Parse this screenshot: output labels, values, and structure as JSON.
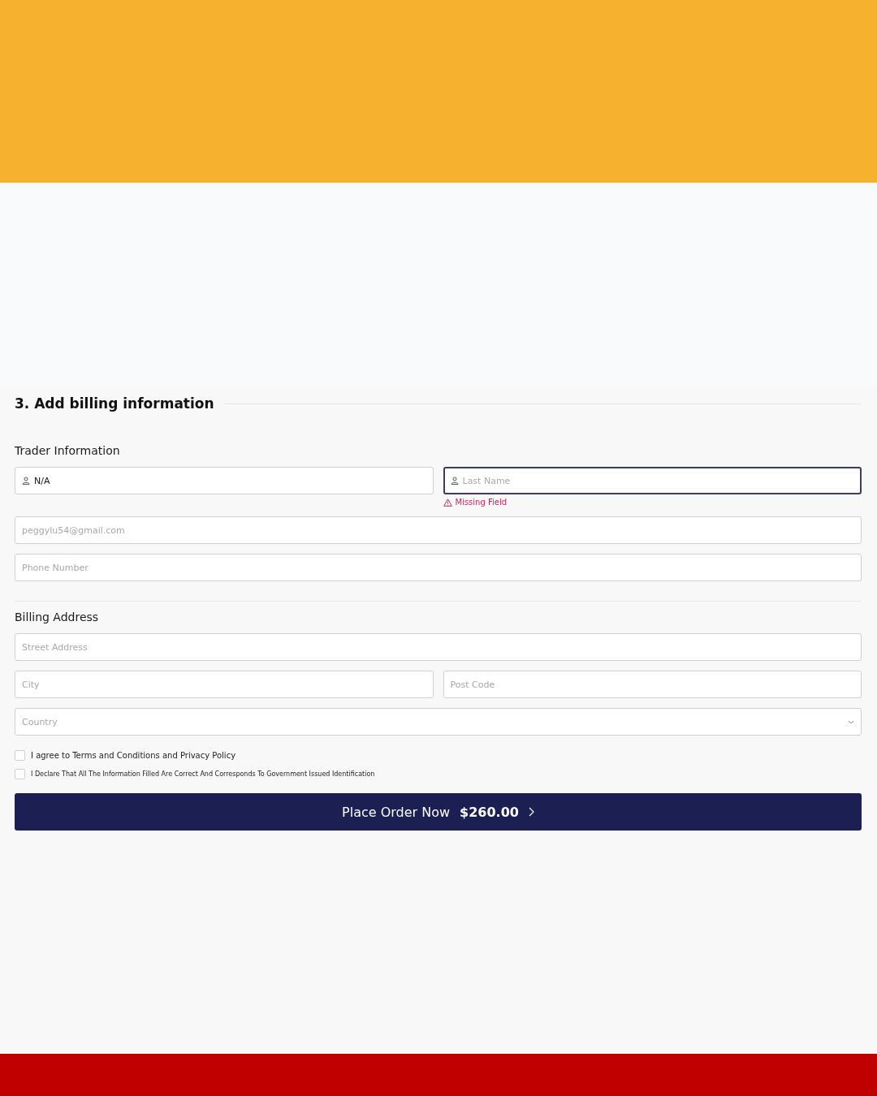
{
  "form": {
    "title": "3. Add billing information",
    "sections": [
      {
        "title": "Trader Information",
        "rows": [
          [
            {
              "kind": "person",
              "value": "N/A",
              "focused": false
            },
            {
              "kind": "person",
              "placeholder": "Last Name",
              "focused": true,
              "error": "Missing Field"
            }
          ],
          [
            {
              "kind": "plain",
              "placeholder": "peggylu54@gmail.com",
              "focused": false
            }
          ],
          [
            {
              "kind": "plain",
              "placeholder": "Phone Number",
              "focused": false
            }
          ]
        ]
      },
      {
        "title": "Billing Address",
        "rows": [
          [
            {
              "kind": "plain",
              "placeholder": "Street Address",
              "focused": false
            }
          ],
          [
            {
              "kind": "plain",
              "placeholder": "City",
              "focused": false
            },
            {
              "kind": "plain",
              "placeholder": "Post Code",
              "focused": false
            }
          ],
          [
            {
              "kind": "select",
              "placeholder": "Country",
              "focused": false
            }
          ]
        ]
      }
    ],
    "agreements": [
      {
        "label": "I agree to Terms and Conditions and Privacy Policy",
        "checked": false,
        "small": false
      },
      {
        "label": "I Declare That All The Information Filled Are Correct And Corresponds To Government Issued Identification",
        "checked": false,
        "small": true
      }
    ],
    "submit": {
      "label": "Place Order Now",
      "price": "$260.00"
    }
  }
}
